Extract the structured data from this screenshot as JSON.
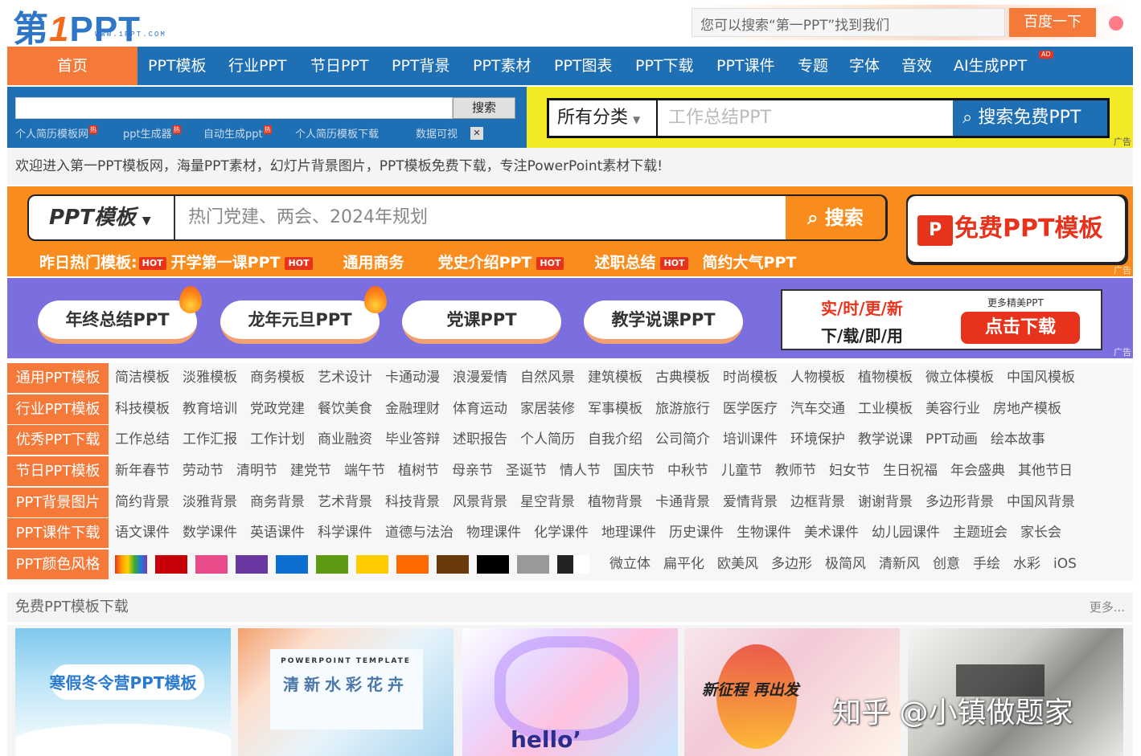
{
  "header": {
    "logo_text": "第1PPT",
    "logo_url": "WWW.1PPT.COM",
    "search_placeholder": "您可以搜索“第一PPT”找到我们",
    "search_button": "百度一下"
  },
  "nav": {
    "items": [
      "首页",
      "PPT模板",
      "行业PPT",
      "节日PPT",
      "PPT背景",
      "PPT素材",
      "PPT图表",
      "PPT下载",
      "PPT课件",
      "专题",
      "字体",
      "音效",
      "AI生成PPT"
    ],
    "ad_tag": "AD"
  },
  "site_search": {
    "button": "搜索",
    "hot_links": [
      "个人简历模板网",
      "ppt生成器",
      "自动生成ppt",
      "个人简历模板下载",
      "数据可视"
    ],
    "hot_badge": "热"
  },
  "yellow_search": {
    "category": "所有分类",
    "placeholder": "工作总结PPT",
    "button": "搜索免费PPT",
    "ad_label": "广告"
  },
  "welcome_text": "欢迎进入第一PPT模板网，海量PPT素材，幻灯片背景图片，PPT模板免费下载，专注PowerPoint素材下载!",
  "orange_banner": {
    "select": "PPT模板",
    "placeholder": "热门党建、两会、2024年规划",
    "search_button": "搜索",
    "free_button": "免费PPT模板",
    "ppt_icon": "P",
    "hot_label": "昨日热门模板:",
    "hot_items": [
      "开学第一课PPT",
      "通用商务",
      "党史介绍PPT",
      "述职总结",
      "简约大气PPT"
    ],
    "hot_tag": "HOT",
    "ad_label": "广告"
  },
  "purple_banner": {
    "pills": [
      "年终总结PPT",
      "龙年元旦PPT",
      "党课PPT",
      "教学说课PPT"
    ],
    "line1": "实/时/更/新",
    "line2": "下/载/即/用",
    "more": "更多精美PPT",
    "download": "点击下载",
    "ad_label": "广告"
  },
  "categories": [
    {
      "label": "通用PPT模板",
      "links": [
        "简洁模板",
        "淡雅模板",
        "商务模板",
        "艺术设计",
        "卡通动漫",
        "浪漫爱情",
        "自然风景",
        "建筑模板",
        "古典模板",
        "时尚模板",
        "人物模板",
        "植物模板",
        "微立体模板",
        "中国风模板"
      ]
    },
    {
      "label": "行业PPT模板",
      "links": [
        "科技模板",
        "教育培训",
        "党政党建",
        "餐饮美食",
        "金融理财",
        "体育运动",
        "家居装修",
        "军事模板",
        "旅游旅行",
        "医学医疗",
        "汽车交通",
        "工业模板",
        "美容行业",
        "房地产模板"
      ]
    },
    {
      "label": "优秀PPT下载",
      "links": [
        "工作总结",
        "工作汇报",
        "工作计划",
        "商业融资",
        "毕业答辩",
        "述职报告",
        "个人简历",
        "自我介绍",
        "公司简介",
        "培训课件",
        "环境保护",
        "教学说课",
        "PPT动画",
        "绘本故事"
      ]
    },
    {
      "label": "节日PPT模板",
      "links": [
        "新年春节",
        "劳动节",
        "清明节",
        "建党节",
        "端午节",
        "植树节",
        "母亲节",
        "圣诞节",
        "情人节",
        "国庆节",
        "中秋节",
        "儿童节",
        "教师节",
        "妇女节",
        "生日祝福",
        "年会盛典",
        "其他节日"
      ]
    },
    {
      "label": "PPT背景图片",
      "links": [
        "简约背景",
        "淡雅背景",
        "商务背景",
        "艺术背景",
        "科技背景",
        "风景背景",
        "星空背景",
        "植物背景",
        "卡通背景",
        "爱情背景",
        "边框背景",
        "谢谢背景",
        "多边形背景",
        "中国风背景"
      ]
    },
    {
      "label": "PPT课件下载",
      "links": [
        "语文课件",
        "数学课件",
        "英语课件",
        "科学课件",
        "道德与法治",
        "物理课件",
        "化学课件",
        "地理课件",
        "历史课件",
        "生物课件",
        "美术课件",
        "幼儿园课件",
        "主题班会",
        "家长会"
      ]
    },
    {
      "label": "PPT颜色风格",
      "links": [
        "微立体",
        "扁平化",
        "欧美风",
        "多边形",
        "极简风",
        "清新风",
        "创意",
        "手绘",
        "水彩",
        "iOS"
      ]
    }
  ],
  "color_swatches": [
    "rainbow",
    "#c8000a",
    "#e84a8a",
    "#6a36a0",
    "#0c6fd0",
    "#5e9a12",
    "#ffcc00",
    "#ff6a00",
    "#6a3a0c",
    "#000000",
    "#999999",
    "black-white"
  ],
  "free_section": {
    "title": "免费PPT模板下载",
    "more": "更多..."
  },
  "thumbnails": [
    {
      "caption": "寒假冬令营PPT模板"
    },
    {
      "caption_top": "POWERPOINT TEMPLATE",
      "caption": "清新水彩花卉"
    },
    {
      "caption": "hello’"
    },
    {
      "caption": "新征程 再出发"
    },
    {
      "caption": ""
    }
  ],
  "watermark": "知乎 @小镇做题家"
}
